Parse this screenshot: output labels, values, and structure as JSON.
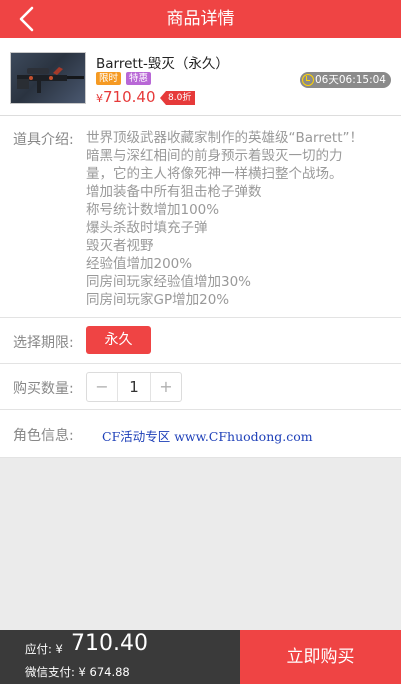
{
  "header": {
    "title": "商品详情",
    "back_icon": "chevron-left-icon"
  },
  "product": {
    "name": "Barrett-毁灭（永久）",
    "tag_limited": "限时",
    "tag_special": "特惠",
    "currency": "¥",
    "price": "710.40",
    "discount": "8.0折",
    "countdown": "06天06:15:04",
    "countdown_icon": "clock-icon"
  },
  "description": {
    "label": "道具介绍:",
    "lines": [
      "世界顶级武器收藏家制作的英雄级“Barrett”！",
      "暗黑与深红相间的前身预示着毁灭一切的力",
      "量，它的主人将像死神一样横扫整个战场。",
      "增加装备中所有狙击枪子弹数",
      "称号统计数增加100%",
      "爆头杀敌时填充子弹",
      "毁灭者视野",
      "经验值增加200%",
      "同房间玩家经验值增加30%",
      "同房间玩家GP增加20%"
    ]
  },
  "period": {
    "label": "选择期限:",
    "option": "永久"
  },
  "quantity": {
    "label": "购买数量:",
    "minus": "−",
    "value": "1",
    "plus": "+"
  },
  "role": {
    "label": "角色信息:",
    "link_text": "CF活动专区 www.CFhuodong.com"
  },
  "footer": {
    "due_label": "应付:",
    "due_currency": "¥",
    "due_amount": "710.40",
    "wechat_label": "微信支付: ¥ 674.88",
    "buy_label": "立即购买"
  },
  "colors": {
    "accent": "#ef4444",
    "dark_bar": "#3a3a3a"
  }
}
